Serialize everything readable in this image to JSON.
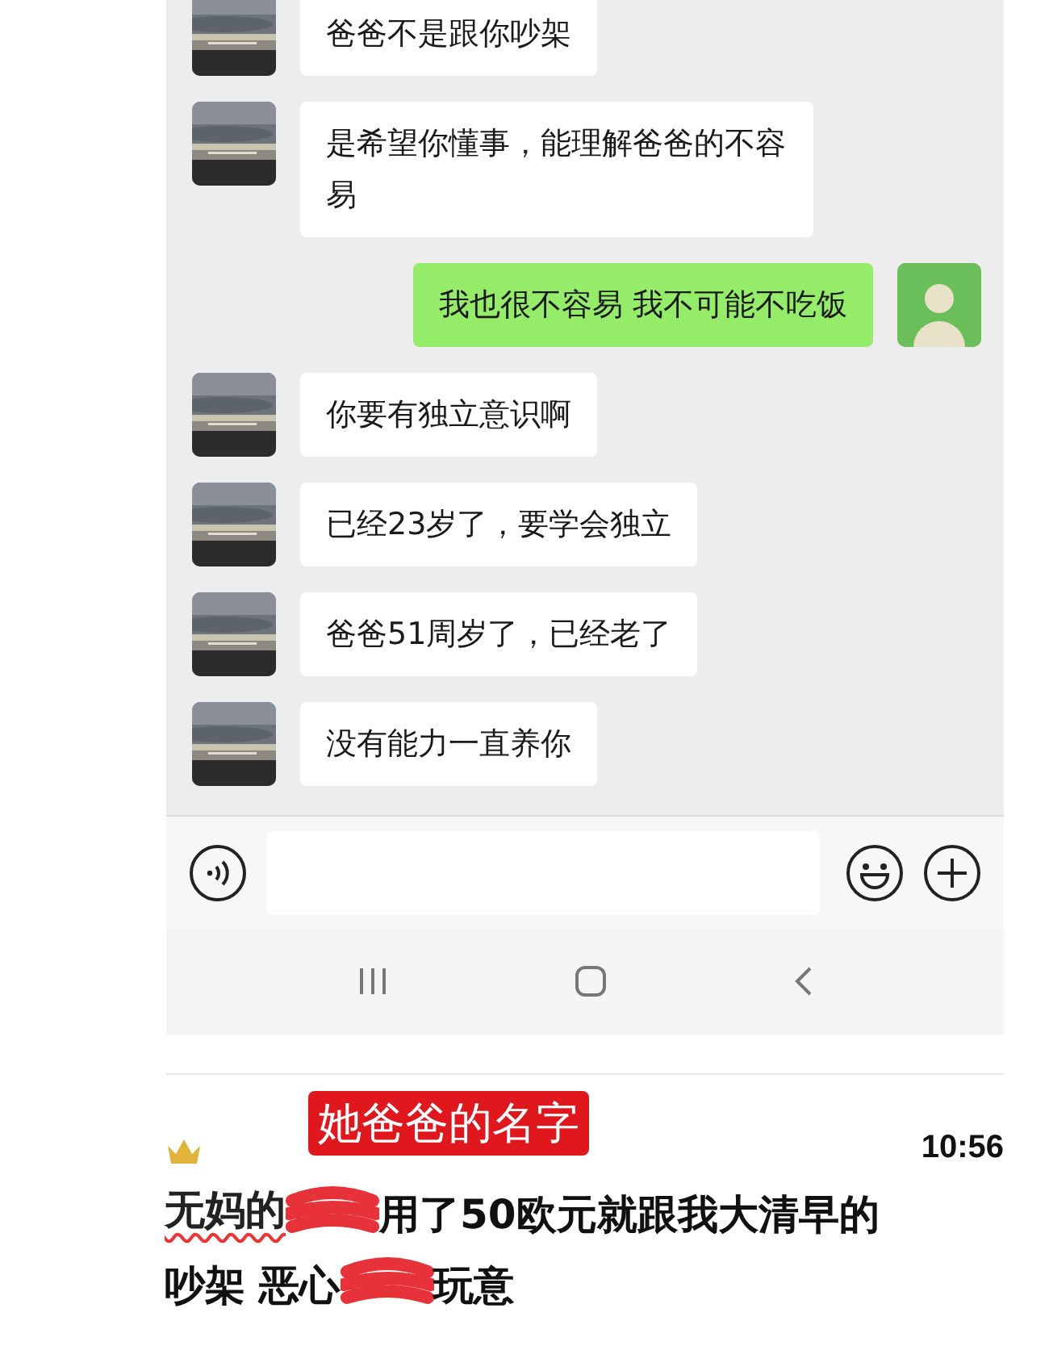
{
  "chat": {
    "messages": [
      {
        "kind": "received",
        "text": "爸爸不是跟你吵架"
      },
      {
        "kind": "received",
        "text": "是希望你懂事，能理解爸爸的不容易"
      },
      {
        "kind": "sent",
        "text": "我也很不容易 我不可能不吃饭"
      },
      {
        "kind": "received",
        "text": "你要有独立意识啊"
      },
      {
        "kind": "received",
        "text": "已经23岁了，要学会独立"
      },
      {
        "kind": "received",
        "text": "爸爸51周岁了，已经老了"
      },
      {
        "kind": "received",
        "text": "没有能力一直养你"
      }
    ]
  },
  "post": {
    "label": "她爸爸的名字",
    "time": "10:56",
    "lines": [
      [
        {
          "kind": "struck",
          "text": "无妈的"
        },
        {
          "kind": "redaction"
        },
        {
          "kind": "text",
          "text": "用了50欧元就跟我大清早的"
        }
      ],
      [
        {
          "kind": "text",
          "text": "吵架 恶心"
        },
        {
          "kind": "redaction"
        },
        {
          "kind": "text",
          "text": "玩意"
        }
      ]
    ]
  }
}
